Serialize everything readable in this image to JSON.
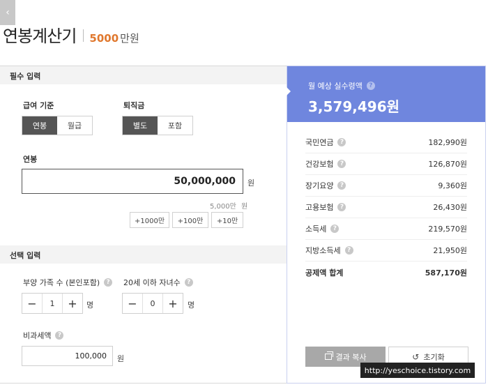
{
  "header": {
    "back_icon": "chevron-left-icon",
    "title": "연봉계산기",
    "subtitle_amount": "5000",
    "subtitle_unit": "만원"
  },
  "required_section": {
    "title": "필수 입력",
    "pay_basis": {
      "label": "급여 기준",
      "options": [
        "연봉",
        "월급"
      ],
      "selected": "연봉"
    },
    "severance": {
      "label": "퇴직금",
      "options": [
        "별도",
        "포함"
      ],
      "selected": "별도"
    },
    "salary": {
      "label": "연봉",
      "value": "50,000,000",
      "unit": "원",
      "hint_amount": "5,000만",
      "hint_unit": "원",
      "add_buttons": [
        "+1000만",
        "+100만",
        "+10만"
      ]
    }
  },
  "optional_section": {
    "title": "선택 입력",
    "dependents": {
      "label": "부양 가족 수 (본인포함)",
      "value": "1",
      "unit": "명"
    },
    "children": {
      "label": "20세 이하 자녀수",
      "value": "0",
      "unit": "명"
    },
    "nontax": {
      "label": "비과세액",
      "value": "100,000",
      "unit": "원"
    }
  },
  "result": {
    "label": "월 예상 실수령액",
    "amount": "3,579,496원",
    "deductions": [
      {
        "name": "국민연금",
        "amount": "182,990원",
        "help": true
      },
      {
        "name": "건강보험",
        "amount": "126,870원",
        "help": true
      },
      {
        "name": "장기요양",
        "amount": "9,360원",
        "help": true
      },
      {
        "name": "고용보험",
        "amount": "26,430원",
        "help": true
      },
      {
        "name": "소득세",
        "amount": "219,570원",
        "help": true
      },
      {
        "name": "지방소득세",
        "amount": "21,950원",
        "help": true
      }
    ],
    "total": {
      "name": "공제액 합계",
      "amount": "587,170원"
    },
    "copy_button": "결과 복사",
    "reset_button": "초기화"
  },
  "watermark": "http://yeschoice.tistory.com",
  "colors": {
    "accent": "#6f86de",
    "highlight": "#e0782e",
    "toggle_active": "#555555"
  }
}
